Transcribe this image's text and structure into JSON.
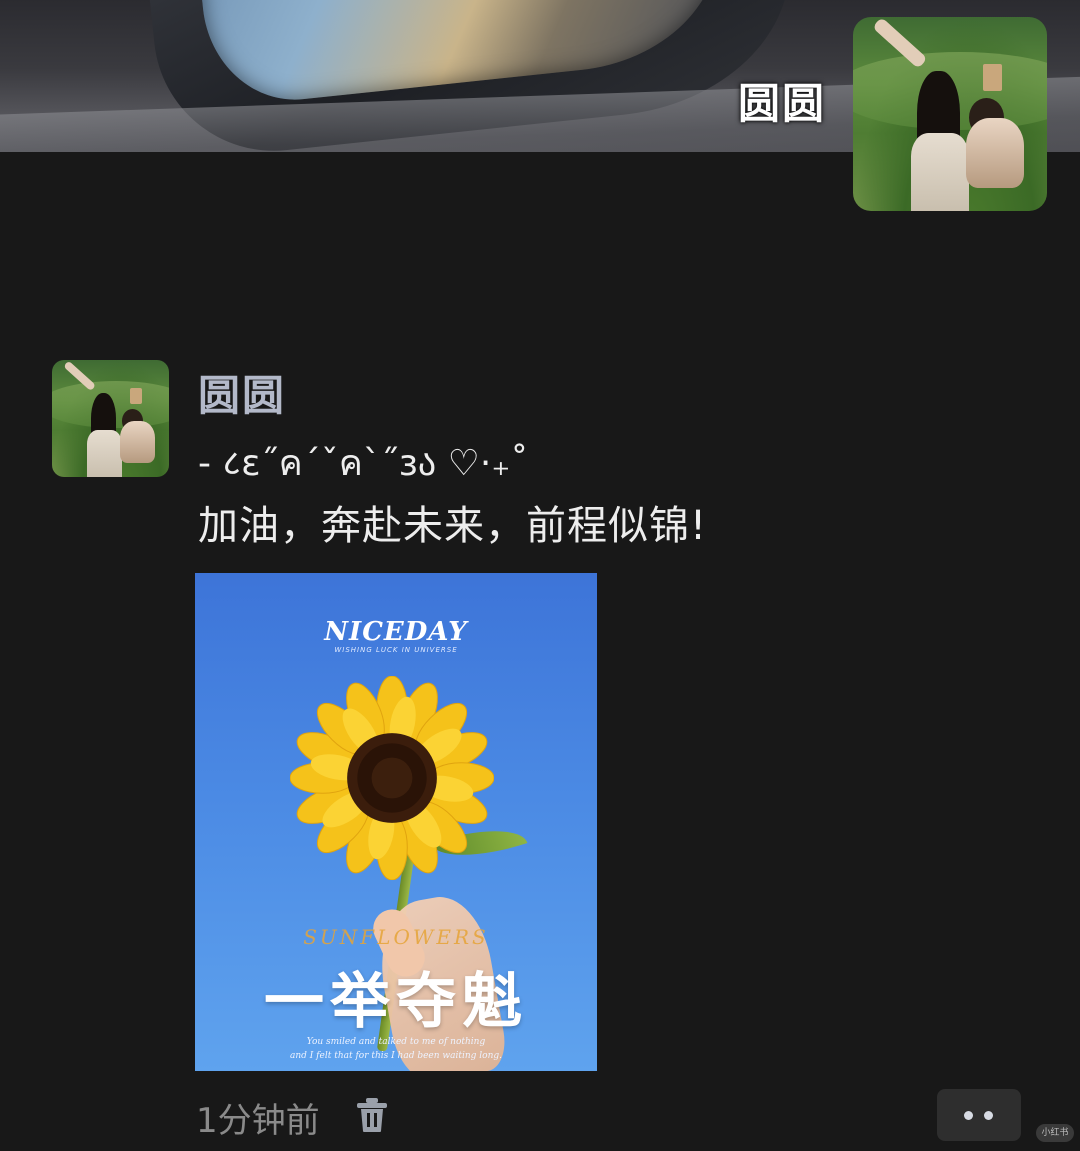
{
  "cover": {
    "name": "圆圆"
  },
  "message": {
    "sender": "圆圆",
    "deco_line": "- ८ε˝ค´ˇค`˝ɜა ♡·₊˚",
    "text": "加油，奔赴未来，前程似锦!",
    "image": {
      "brand": "NICEDAY",
      "brand_sub": "WISHING LUCK IN UNIVERSE",
      "script": "SUNFLOWERS",
      "title": "一举夺魁",
      "quote_line1": "You smiled and talked to me of nothing",
      "quote_line2": "and I felt that for this I had been waiting long."
    },
    "time": "1分钟前"
  },
  "icons": {
    "trash": "trash-icon",
    "more": "more-dots-icon"
  },
  "watermark": "小红书",
  "colors": {
    "background": "#181818",
    "name_accent": "#b3b9c9",
    "poster_sky": "#4b8ae4",
    "sunflower": "#f5c21a"
  }
}
